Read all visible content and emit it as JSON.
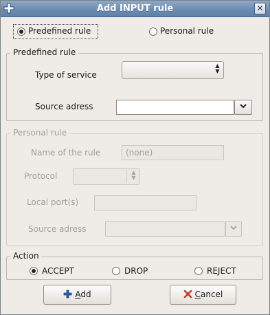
{
  "window": {
    "title": "Add INPUT rule",
    "app_icon": "move-cross-icon",
    "close_icon": "close-icon",
    "close_glyph": "✕"
  },
  "rule_type": {
    "options": [
      {
        "label": "Predefined rule",
        "selected": true
      },
      {
        "label": "Personal rule",
        "selected": false
      }
    ]
  },
  "predefined": {
    "legend": "Predefined rule",
    "service_label": "Type of service",
    "service_value": "",
    "source_label": "Source adress",
    "source_value": ""
  },
  "personal": {
    "legend": "Personal rule",
    "name_label": "Name of the rule",
    "name_value": "(none)",
    "protocol_label": "Protocol",
    "protocol_value": "",
    "port_label": "Local port(s)",
    "port_value": "",
    "source_label": "Source adress",
    "source_value": ""
  },
  "action": {
    "legend": "Action",
    "options": [
      {
        "label": "ACCEPT",
        "selected": true
      },
      {
        "label": "DROP",
        "selected": false
      },
      {
        "label": "REJECT",
        "selected": false
      }
    ]
  },
  "buttons": {
    "add": {
      "mnemonic": "A",
      "rest": "dd",
      "icon": "add-plus-icon"
    },
    "cancel": {
      "mnemonic": "C",
      "rest": "ancel",
      "icon": "cancel-x-icon"
    }
  },
  "colors": {
    "titlebar": "#6d8db3",
    "window_bg": "#efebe7",
    "add_icon": "#2e5fa8",
    "cancel_icon": "#c0392b"
  }
}
